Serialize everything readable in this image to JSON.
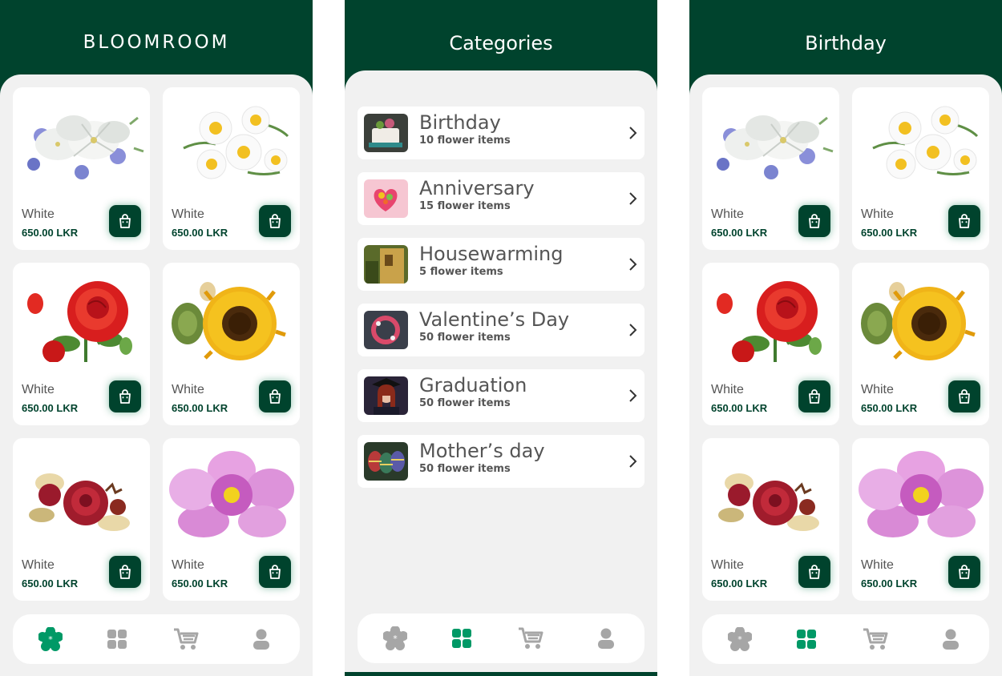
{
  "screen_home": {
    "title": "BLOOMROOM",
    "products": [
      {
        "name": "White",
        "price": "650.00 LKR",
        "image": "white-lily-bouquet"
      },
      {
        "name": "White",
        "price": "650.00 LKR",
        "image": "daisy-bunch"
      },
      {
        "name": "White",
        "price": "650.00 LKR",
        "image": "red-rose"
      },
      {
        "name": "White",
        "price": "650.00 LKR",
        "image": "sunflower"
      },
      {
        "name": "White",
        "price": "650.00 LKR",
        "image": "burgundy-roses"
      },
      {
        "name": "White",
        "price": "650.00 LKR",
        "image": "pink-cosmos"
      }
    ],
    "nav_active": "home"
  },
  "screen_categories": {
    "title": "Categories",
    "categories": [
      {
        "name": "Birthday",
        "count": "10 flower items",
        "thumb": "cake-photo"
      },
      {
        "name": "Anniversary",
        "count": "15 flower items",
        "thumb": "heart-bouquet-photo"
      },
      {
        "name": "Housewarming",
        "count": "5 flower items",
        "thumb": "house-photo"
      },
      {
        "name": "Valentine’s Day",
        "count": "50 flower items",
        "thumb": "heart-wreath-photo"
      },
      {
        "name": "Graduation",
        "count": "50 flower items",
        "thumb": "graduate-photo"
      },
      {
        "name": "Mother’s day",
        "count": "50 flower items",
        "thumb": "easter-eggs-photo"
      }
    ],
    "nav_active": "categories"
  },
  "screen_birthday": {
    "title": "Birthday",
    "products": [
      {
        "name": "White",
        "price": "650.00 LKR",
        "image": "white-lily-bouquet"
      },
      {
        "name": "White",
        "price": "650.00 LKR",
        "image": "daisy-bunch"
      },
      {
        "name": "White",
        "price": "650.00 LKR",
        "image": "red-rose"
      },
      {
        "name": "White",
        "price": "650.00 LKR",
        "image": "sunflower"
      },
      {
        "name": "White",
        "price": "650.00 LKR",
        "image": "burgundy-roses"
      },
      {
        "name": "White",
        "price": "650.00 LKR",
        "image": "pink-cosmos"
      }
    ],
    "nav_active": "categories"
  },
  "nav_icons": [
    "flower-icon",
    "grid-icon",
    "cart-icon",
    "user-icon"
  ],
  "colors": {
    "brand": "#00432d",
    "accent": "#009966",
    "icon_inactive": "#a6a6a6",
    "background": "#f1f1f1"
  }
}
